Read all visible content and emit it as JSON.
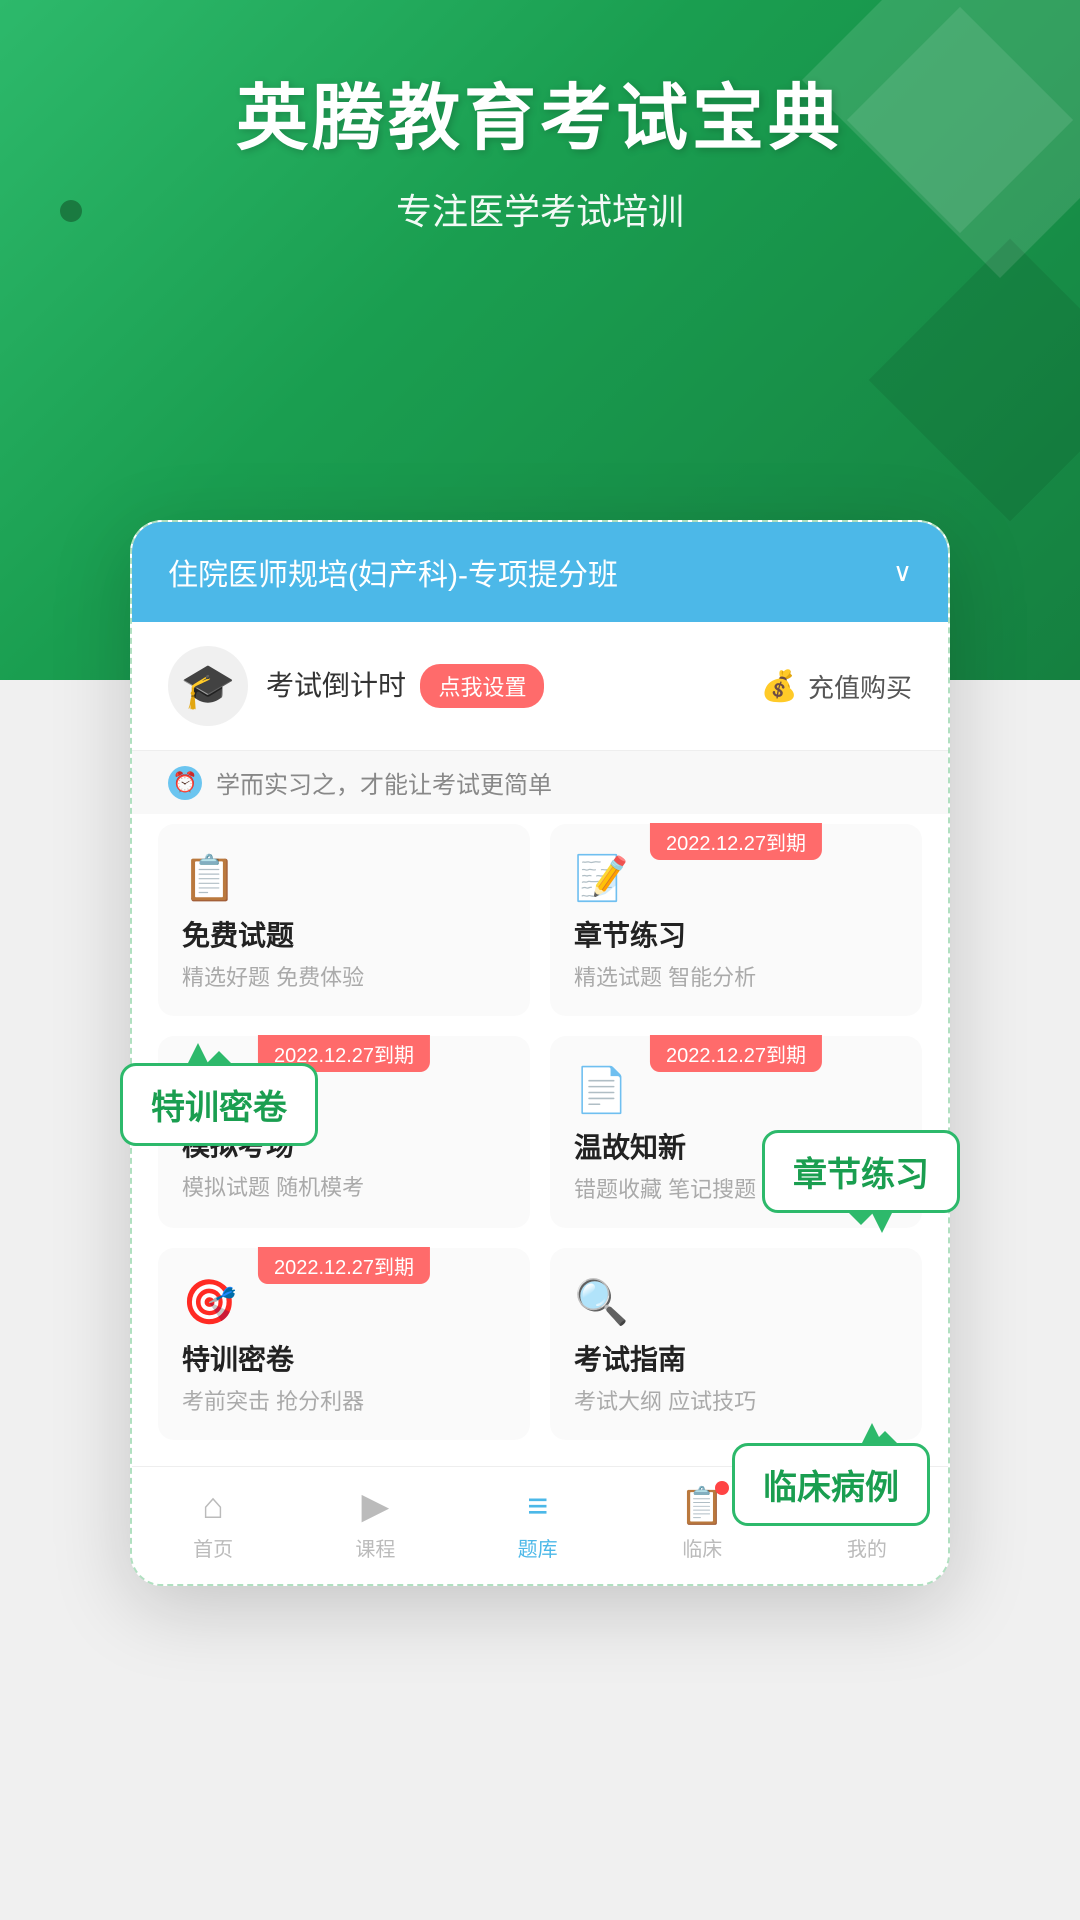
{
  "hero": {
    "title": "英腾教育考试宝典",
    "subtitle": "专注医学考试培训"
  },
  "app": {
    "header": {
      "title": "住院医师规培(妇产科)-专项提分班",
      "arrow": "∨"
    },
    "countdown": {
      "label": "考试倒计时",
      "btn": "点我设置",
      "recharge": "充值购买"
    },
    "motto": "学而实习之，才能让考试更简单",
    "grid": [
      {
        "id": "free",
        "title": "免费试题",
        "desc": "精选好题 免费体验",
        "tag": null,
        "icon": "📋"
      },
      {
        "id": "chapter",
        "title": "章节练习",
        "desc": "精选试题 智能分析",
        "tag": "2022.12.27到期",
        "icon": "📝"
      },
      {
        "id": "mock",
        "title": "模拟考场",
        "desc": "模拟试题 随机模考",
        "tag": "2022.12.27到期",
        "icon": "⏱"
      },
      {
        "id": "review",
        "title": "温故知新",
        "desc": "错题收藏 笔记搜题",
        "tag": "2022.12.27到期",
        "icon": "📄"
      },
      {
        "id": "secret",
        "title": "特训密卷",
        "desc": "考前突击 抢分利器",
        "tag": "2022.12.27到期",
        "icon": "🎯"
      },
      {
        "id": "guide",
        "title": "考试指南",
        "desc": "考试大纲 应试技巧",
        "tag": null,
        "icon": "🔍"
      }
    ],
    "nav": [
      {
        "id": "home",
        "icon": "⌂",
        "label": "首页",
        "active": false
      },
      {
        "id": "course",
        "icon": "▶",
        "label": "课程",
        "active": false
      },
      {
        "id": "question",
        "icon": "≡",
        "label": "题库",
        "active": true
      },
      {
        "id": "clinical",
        "icon": "📋",
        "label": "临床",
        "active": false,
        "badge": true
      },
      {
        "id": "mine",
        "icon": "○",
        "label": "我的",
        "active": false
      }
    ]
  },
  "callouts": {
    "chapter": "章节练习",
    "secret": "特训密卷",
    "clinical": "临床病例"
  }
}
